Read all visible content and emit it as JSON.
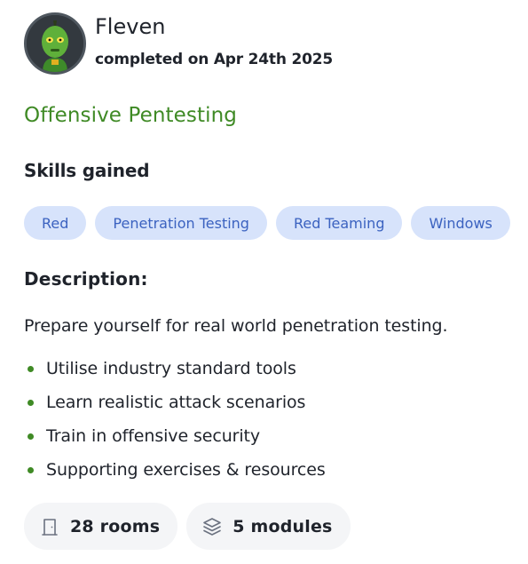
{
  "profile": {
    "avatar_icon": "alien-avatar-icon",
    "name": "Fleven",
    "completed": "completed on Apr 24th 2025"
  },
  "path": {
    "title": "Offensive Pentesting",
    "title_color": "#3f8a25"
  },
  "skills": {
    "heading": "Skills gained",
    "tags": [
      "Red",
      "Penetration Testing",
      "Red Teaming",
      "Windows"
    ],
    "tag_bg": "#d7e3fb",
    "tag_text": "#3b62c0"
  },
  "description": {
    "heading": "Description:",
    "intro": "Prepare yourself for real world penetration testing.",
    "bullets": [
      "Utilise industry standard tools",
      "Learn realistic attack scenarios",
      "Train in offensive security",
      "Supporting exercises & resources"
    ]
  },
  "stats": {
    "rooms": {
      "icon": "door-icon",
      "label": "28 rooms"
    },
    "modules": {
      "icon": "layers-icon",
      "label": "5 modules"
    }
  }
}
